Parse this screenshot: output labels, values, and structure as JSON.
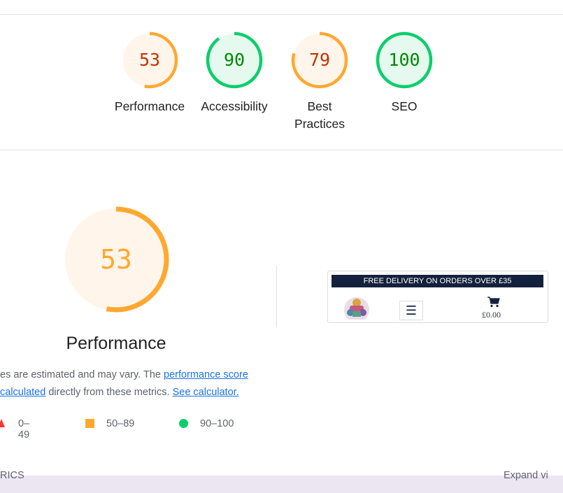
{
  "scores": [
    {
      "label": "Performance",
      "value": "53",
      "fraction": 0.53,
      "status": "average"
    },
    {
      "label": "Accessibility",
      "value": "90",
      "fraction": 0.9,
      "status": "pass"
    },
    {
      "label": "Best Practices",
      "value": "79",
      "fraction": 0.79,
      "status": "average"
    },
    {
      "label": "SEO",
      "value": "100",
      "fraction": 1.0,
      "status": "pass"
    }
  ],
  "colors": {
    "average_ring": "#ffa830",
    "average_fill": "#fff5ea",
    "average_text": "#c33300",
    "average_text_big": "#ffa830",
    "pass_ring": "#0cce6b",
    "pass_fill": "#e6f9ee",
    "pass_text": "#008800",
    "fail": "#ff3333",
    "banner": "#14213d"
  },
  "performance": {
    "title": "Performance",
    "value": "53",
    "fraction": 0.53,
    "desc_part1": "es are estimated and may vary. The ",
    "link_score": "performance score",
    "link_calculated": "calculated",
    "desc_part2": " directly from these metrics. ",
    "link_calculator": "See calculator."
  },
  "legend": {
    "fail": "0–49",
    "average": "50–89",
    "pass": "90–100"
  },
  "thumbnail": {
    "banner": "FREE DELIVERY ON ORDERS OVER £35",
    "menu_glyph": "☰",
    "price": "£0.00"
  },
  "clipped": {
    "left": "RICS",
    "right": "Expand vi"
  }
}
